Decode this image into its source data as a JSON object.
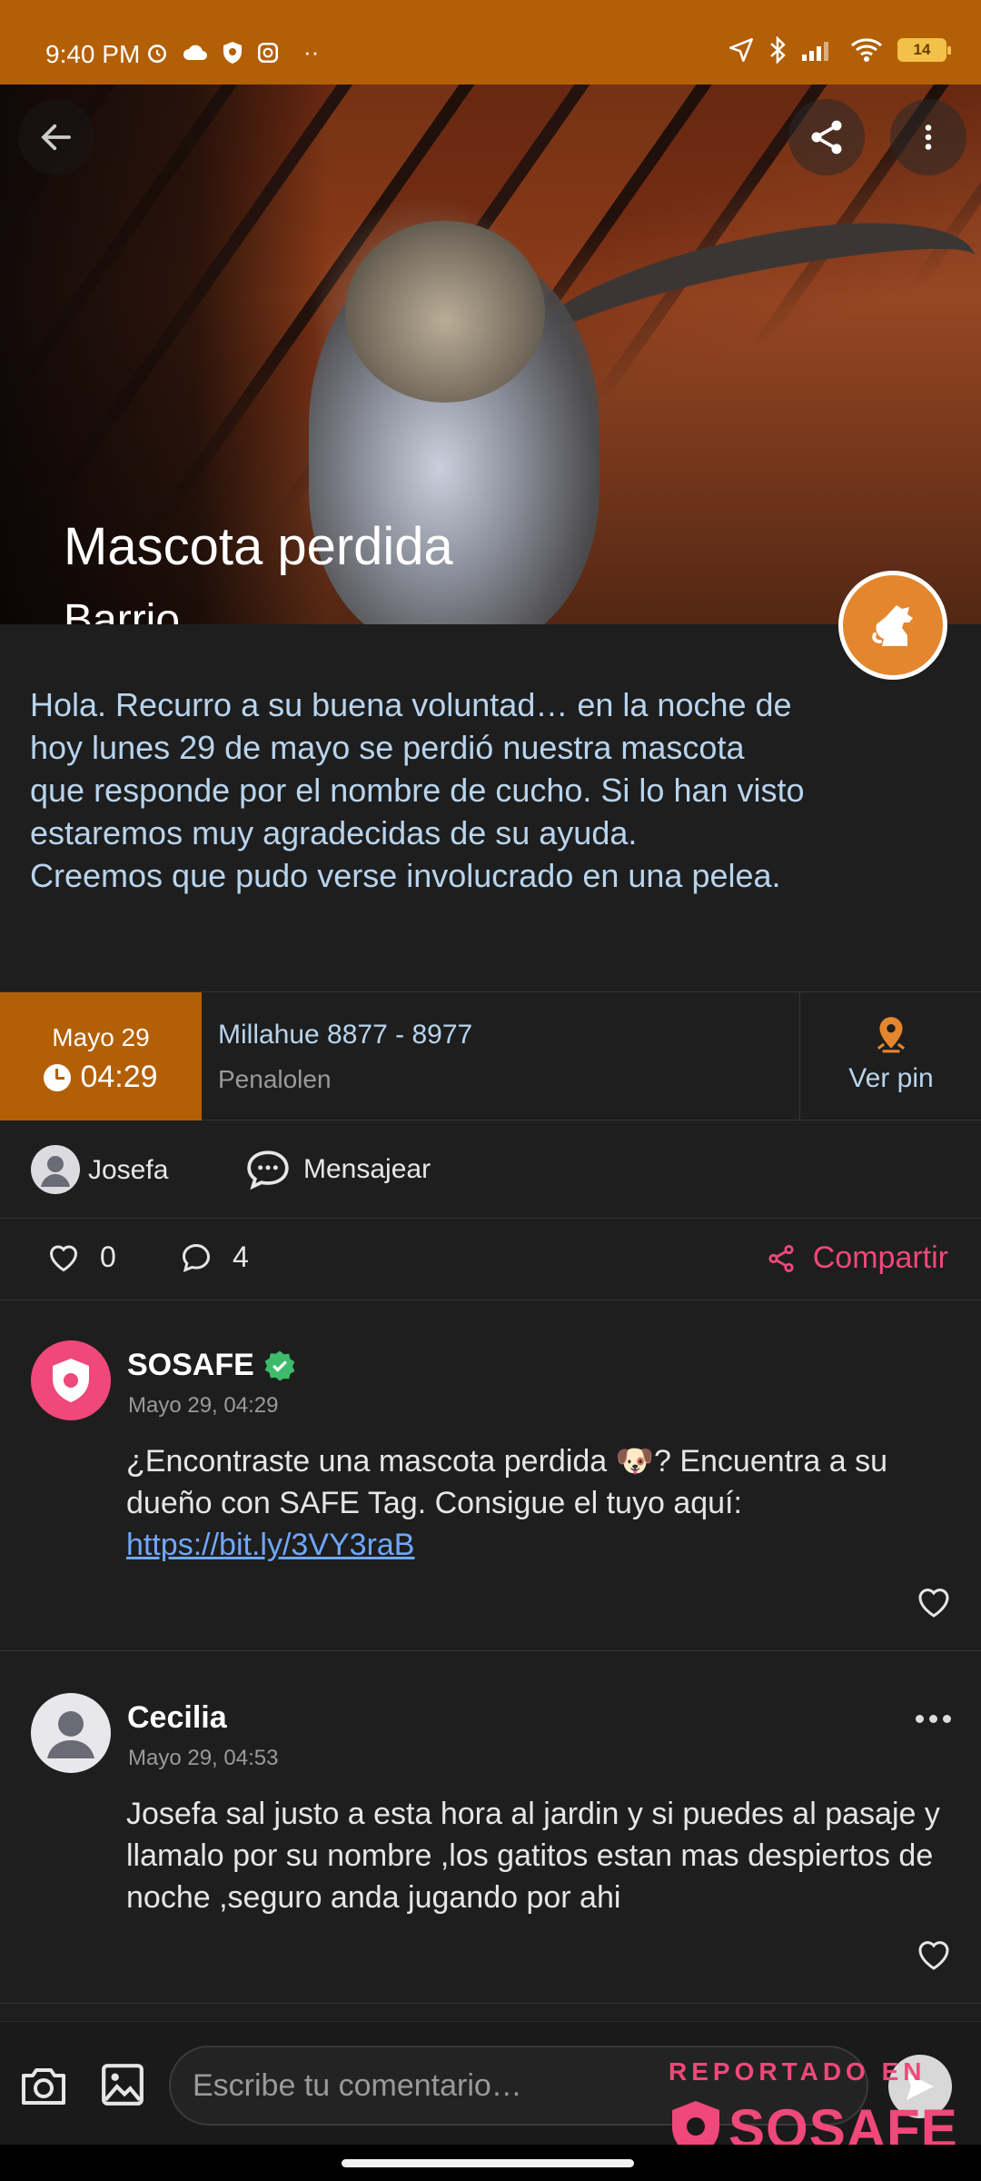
{
  "status_bar": {
    "time": "9:40 PM",
    "battery": "14"
  },
  "hero": {
    "title": "Mascota perdida",
    "subtitle": "Barrio"
  },
  "post": {
    "description": "Hola. Recurro a su buena voluntad… en la noche de\nhoy lunes 29 de mayo se perdió nuestra mascota\nque responde por el nombre de cucho. Si lo han visto\nestaremos muy agradecidas de su ayuda.\nCreemos que pudo verse involucrado en una pelea.",
    "date": "Mayo 29",
    "time": "04:29",
    "address": "Millahue  8877 - 8977",
    "commune": "Penalolen",
    "pin_label": "Ver pin"
  },
  "author": {
    "name": "Josefa",
    "message_label": "Mensajear"
  },
  "stats": {
    "likes": "0",
    "comments": "4",
    "share_label": "Compartir"
  },
  "comments": [
    {
      "author": "SOSAFE",
      "date": "Mayo 29, 04:29",
      "text_before_link": "¿Encontraste una mascota perdida 🐶? Encuentra a su dueño con SAFE Tag. Consigue el tuyo aquí:",
      "link": "https://bit.ly/3VY3raB"
    },
    {
      "author": "Cecilia",
      "date": "Mayo 29, 04:53",
      "text": "Josefa sal justo a esta hora al jardin y si puedes al pasaje y llamalo por su nombre ,los gatitos estan mas despiertos de noche ,seguro anda jugando por ahi"
    }
  ],
  "composer": {
    "placeholder": "Escribe tu comentario…"
  },
  "watermark": {
    "caption": "REPORTADO EN",
    "brand": "SOSAFE"
  },
  "colors": {
    "accent_orange": "#b35f05",
    "brand_pink": "#f0487a",
    "badge_orange": "#e3862d",
    "verified_green": "#3dbb6b",
    "link_blue": "#6fa8ff"
  },
  "icons": [
    "back-arrow-icon",
    "share-icon",
    "more-vertical-icon",
    "dog-icon",
    "clock-icon",
    "location-pin-icon",
    "user-icon",
    "chat-bubble-icon",
    "heart-icon",
    "comment-icon",
    "share-nodes-icon",
    "verified-badge-icon",
    "more-horizontal-icon",
    "camera-icon",
    "image-icon",
    "send-icon"
  ]
}
